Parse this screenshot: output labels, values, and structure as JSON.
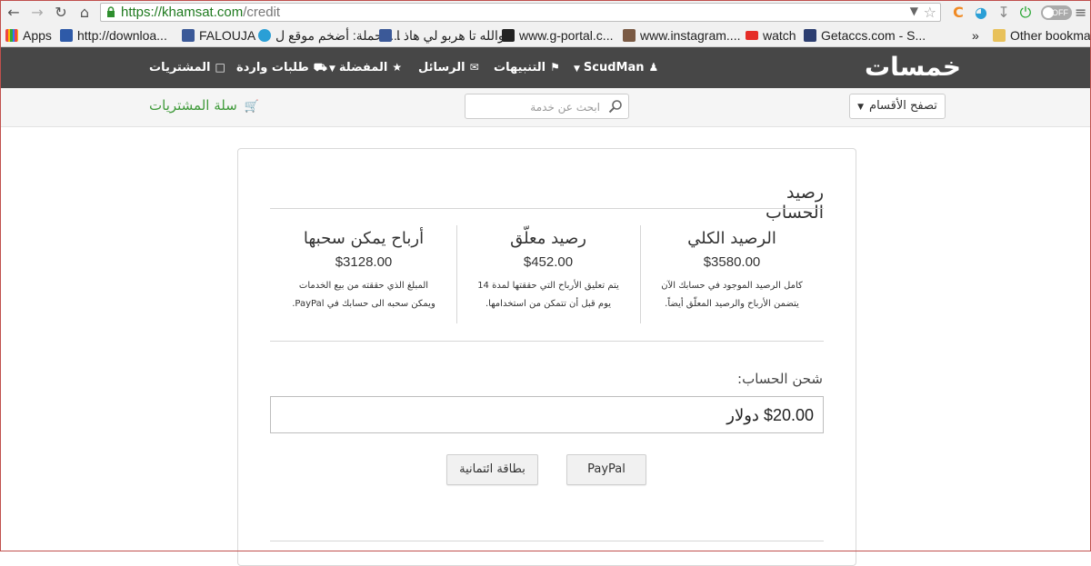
{
  "browser": {
    "url_host": "https://khamsat.com",
    "url_path": "/credit",
    "toggle_label": "OFF",
    "bookmarks": [
      {
        "label": "Apps",
        "icon": "apps-grid-icon"
      },
      {
        "label": "http://downloa...",
        "icon": "book-icon"
      },
      {
        "label": "FALOUJA",
        "icon": "facebook-icon"
      },
      {
        "label": "الحملة: أضخم موقع ل...",
        "icon": "globe-icon"
      },
      {
        "label": "والله تا هربو لي هاذ ا...",
        "icon": "facebook-icon"
      },
      {
        "label": "www.g-portal.c...",
        "icon": "gportal-icon"
      },
      {
        "label": "www.instagram....",
        "icon": "instagram-icon"
      },
      {
        "label": "watch",
        "icon": "youtube-icon"
      },
      {
        "label": "Getaccs.com - S...",
        "icon": "s-icon"
      },
      {
        "label": "»",
        "icon": ""
      },
      {
        "label": "Other bookmarks",
        "icon": "folder-icon"
      }
    ]
  },
  "header": {
    "logo": "خمسات",
    "nav": {
      "user": "ScudMan",
      "notifications": "التنبيهات",
      "messages": "الرسائل",
      "favorites": "المفضلة",
      "incoming": "طلبات واردة",
      "purchases": "المشتريات"
    }
  },
  "subheader": {
    "browse": "تصفح الأقسام",
    "search_placeholder": "ابحث عن خدمة",
    "cart": "سلة المشتريات"
  },
  "credit": {
    "title": "رصيد الحساب",
    "columns": [
      {
        "title": "الرصيد الكلي",
        "amount": "$3580.00",
        "desc1": "كامل الرصيد الموجود في حسابك الآن",
        "desc2": "يتضمن الأرباح والرصيد المعلّق أيضاً."
      },
      {
        "title": "رصيد معلّق",
        "amount": "$452.00",
        "desc1": "يتم تعليق الأرباح التي حققتها لمدة 14",
        "desc2": "يوم قبل أن تتمكن من استخدامها."
      },
      {
        "title": "أرباح يمكن سحبها",
        "amount": "$3128.00",
        "desc1": "المبلغ الذي حققته من بيع الخدمات",
        "desc2": "ويمكن سحبه الى حسابك في PayPal."
      }
    ],
    "charge_label": "شحن الحساب:",
    "charge_value": "$20.00 دولار",
    "buttons": {
      "paypal": "PayPal",
      "credit_card": "بطاقة ائتمانية"
    }
  },
  "colors": {
    "header_bg": "#474747",
    "logo_accent": "#e8a33b",
    "cart_green": "#3f9a3a"
  }
}
